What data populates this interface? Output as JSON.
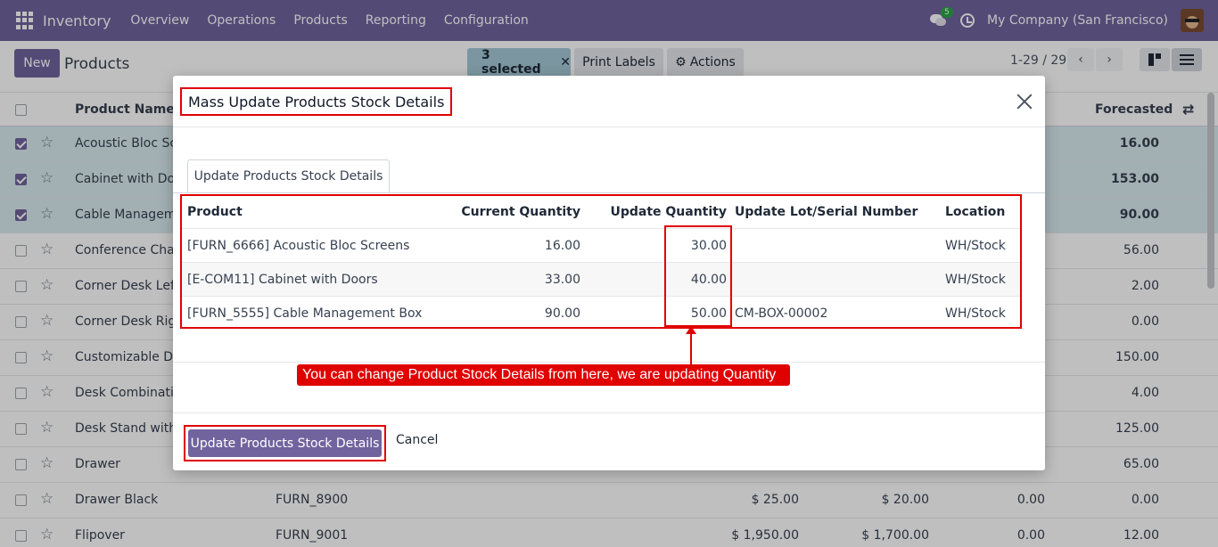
{
  "navbar": {
    "app_name": "Inventory",
    "menu": [
      "Overview",
      "Operations",
      "Products",
      "Reporting",
      "Configuration"
    ],
    "chat_badge": "5",
    "company": "My Company (San Francisco)"
  },
  "control_panel": {
    "new_label": "New",
    "title": "Products",
    "selected_label": "3 selected",
    "print_labels": "Print Labels",
    "actions": "Actions",
    "pager": "1-29 / 29"
  },
  "list": {
    "header": {
      "product_name": "Product Name",
      "forecasted": "Forecasted"
    },
    "rows": [
      {
        "name": "Acoustic Bloc Scre",
        "ref": "",
        "sale": "",
        "cost": "",
        "onhand": "",
        "forecast": "16.00",
        "selected": true
      },
      {
        "name": "Cabinet with Door",
        "ref": "",
        "sale": "",
        "cost": "",
        "onhand": "",
        "forecast": "153.00",
        "selected": true
      },
      {
        "name": "Cable Manageme",
        "ref": "",
        "sale": "",
        "cost": "",
        "onhand": "",
        "forecast": "90.00",
        "selected": true
      },
      {
        "name": "Conference Chair",
        "ref": "",
        "sale": "",
        "cost": "",
        "onhand": "",
        "forecast": "56.00",
        "selected": false
      },
      {
        "name": "Corner Desk Left",
        "ref": "",
        "sale": "",
        "cost": "",
        "onhand": "",
        "forecast": "2.00",
        "selected": false
      },
      {
        "name": "Corner Desk Righ",
        "ref": "",
        "sale": "",
        "cost": "",
        "onhand": "",
        "forecast": "0.00",
        "selected": false
      },
      {
        "name": "Customizable Des",
        "ref": "",
        "sale": "",
        "cost": "",
        "onhand": "",
        "forecast": "150.00",
        "selected": false
      },
      {
        "name": "Desk Combination",
        "ref": "",
        "sale": "",
        "cost": "",
        "onhand": "",
        "forecast": "4.00",
        "selected": false
      },
      {
        "name": "Desk Stand with S",
        "ref": "",
        "sale": "",
        "cost": "",
        "onhand": "",
        "forecast": "125.00",
        "selected": false
      },
      {
        "name": "Drawer",
        "ref": "",
        "sale": "",
        "cost": "",
        "onhand": "",
        "forecast": "65.00",
        "selected": false
      },
      {
        "name": "Drawer Black",
        "ref": "FURN_8900",
        "sale": "$ 25.00",
        "cost": "$ 20.00",
        "onhand": "0.00",
        "forecast": "0.00",
        "selected": false
      },
      {
        "name": "Flipover",
        "ref": "FURN_9001",
        "sale": "$ 1,950.00",
        "cost": "$ 1,700.00",
        "onhand": "0.00",
        "forecast": "12.00",
        "selected": false
      }
    ]
  },
  "modal": {
    "title": "Mass Update Products Stock Details",
    "tab": "Update Products Stock Details",
    "columns": {
      "product": "Product",
      "current_qty": "Current Quantity",
      "update_qty": "Update Quantity",
      "lot": "Update Lot/Serial Number",
      "location": "Location"
    },
    "rows": [
      {
        "product": "[FURN_6666] Acoustic Bloc Screens",
        "current": "16.00",
        "update": "30.00",
        "lot": "",
        "location": "WH/Stock"
      },
      {
        "product": "[E-COM11] Cabinet with Doors",
        "current": "33.00",
        "update": "40.00",
        "lot": "",
        "location": "WH/Stock"
      },
      {
        "product": "[FURN_5555] Cable Management Box",
        "current": "90.00",
        "update": "50.00",
        "lot": "CM-BOX-00002",
        "location": "WH/Stock"
      }
    ],
    "callout": "You can change Product Stock Details from here, we are updating Quantity",
    "primary_button": "Update Products Stock Details",
    "cancel_button": "Cancel"
  },
  "colors": {
    "brand": "#71639e",
    "annotation_red": "#e00000",
    "selection": "#a4c9d6"
  }
}
